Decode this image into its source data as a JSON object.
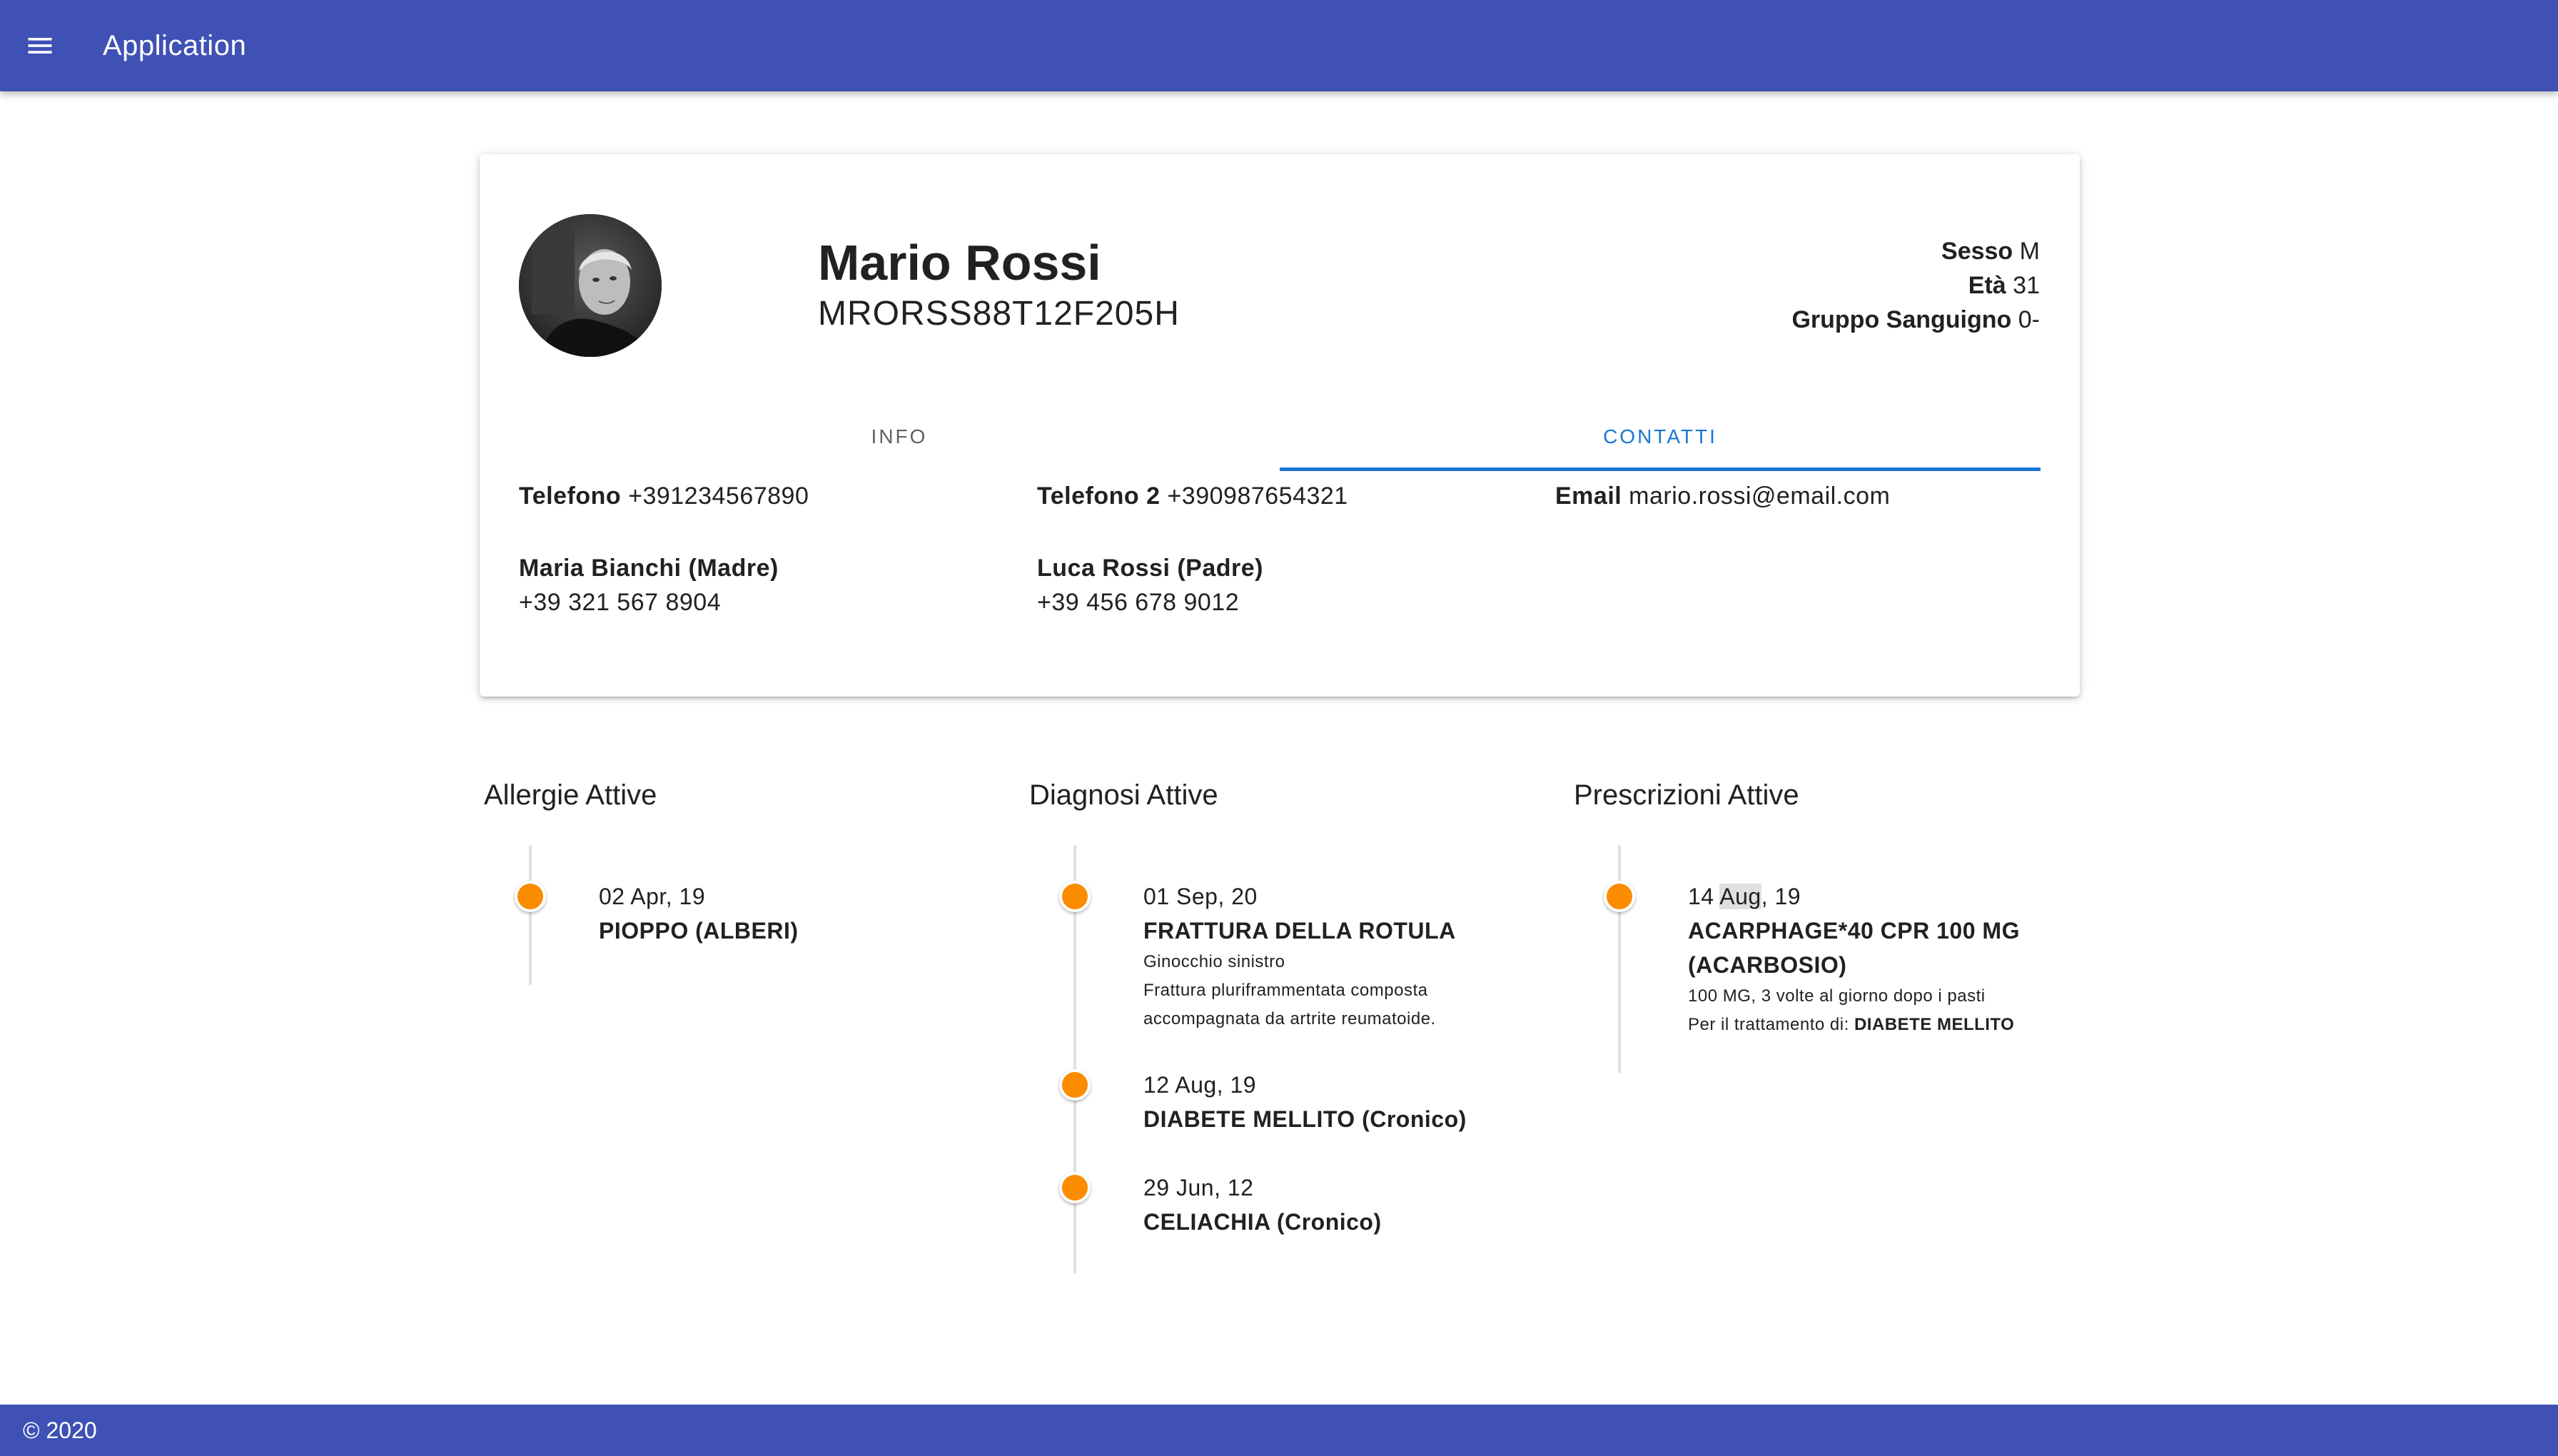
{
  "appbar": {
    "menu_icon": "menu-icon",
    "title": "Application"
  },
  "patient": {
    "name": "Mario Rossi",
    "fiscal_code": "MRORSS88T12F205H",
    "meta": {
      "sex_label": "Sesso",
      "sex_value": "M",
      "age_label": "Età",
      "age_value": "31",
      "blood_label": "Gruppo Sanguigno",
      "blood_value": "0-"
    }
  },
  "tabs": [
    {
      "label": "INFO",
      "active": false
    },
    {
      "label": "CONTATTI",
      "active": true
    }
  ],
  "contacts": {
    "phone_label": "Telefono",
    "phone_value": "+391234567890",
    "phone2_label": "Telefono 2",
    "phone2_value": "+390987654321",
    "email_label": "Email",
    "email_value": "mario.rossi@email.com",
    "relatives": [
      {
        "name": "Maria Bianchi (Madre)",
        "phone": "+39 321 567 8904"
      },
      {
        "name": "Luca Rossi (Padre)",
        "phone": "+39 456 678 9012"
      }
    ]
  },
  "allergies": {
    "title": "Allergie Attive",
    "items": [
      {
        "date": "02 Apr, 19",
        "name": "PIOPPO (ALBERI)"
      }
    ]
  },
  "diagnoses": {
    "title": "Diagnosi Attive",
    "items": [
      {
        "date": "01 Sep, 20",
        "name": "FRATTURA DELLA ROTULA",
        "detail1": "Ginocchio sinistro",
        "detail2": "Frattura pluriframmentata composta",
        "detail3": "accompagnata da artrite reumatoide."
      },
      {
        "date": "12 Aug, 19",
        "name": "DIABETE MELLITO (Cronico)"
      },
      {
        "date": "29 Jun, 12",
        "name": "CELIACHIA (Cronico)"
      }
    ]
  },
  "prescriptions": {
    "title": "Prescrizioni Attive",
    "items": [
      {
        "date_day": "14",
        "date_month": "Aug",
        "date_year": ", 19",
        "name_line1": "ACARPHAGE*40 CPR 100 MG",
        "name_line2": "(ACARBOSIO)",
        "dosage": "100 MG, 3 volte al giorno dopo i pasti",
        "treatment_label": "Per il trattamento di:",
        "treatment_value": "DIABETE MELLITO"
      }
    ]
  },
  "footer": {
    "text": "© 2020"
  },
  "colors": {
    "primary": "#3f51b5",
    "accent": "#1976d2",
    "timeline_dot": "#fb8c00"
  }
}
